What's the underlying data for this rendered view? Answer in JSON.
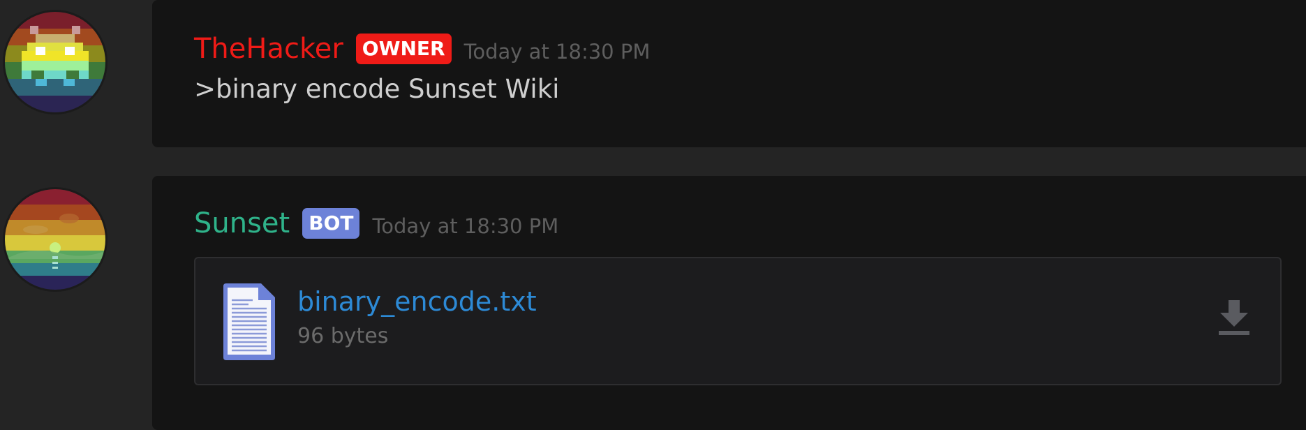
{
  "messages": [
    {
      "username": "TheHacker",
      "badge": "OWNER",
      "timestamp": "Today at 18:30 PM",
      "content": ">binary encode Sunset Wiki",
      "avatar_icon": "pixel-invader-avatar-icon"
    },
    {
      "username": "Sunset",
      "badge": "BOT",
      "timestamp": "Today at 18:30 PM",
      "avatar_icon": "sunset-landscape-avatar-icon",
      "attachment": {
        "file_name": "binary_encode.txt",
        "file_size": "96 bytes",
        "file_icon": "text-document-icon",
        "action_icon": "download-icon"
      }
    }
  ],
  "colors": {
    "owner_red": "#ef1b17",
    "bot_green": "#2fb38a",
    "bot_badge": "#6d82d8",
    "link_blue": "#2d8ad6"
  }
}
